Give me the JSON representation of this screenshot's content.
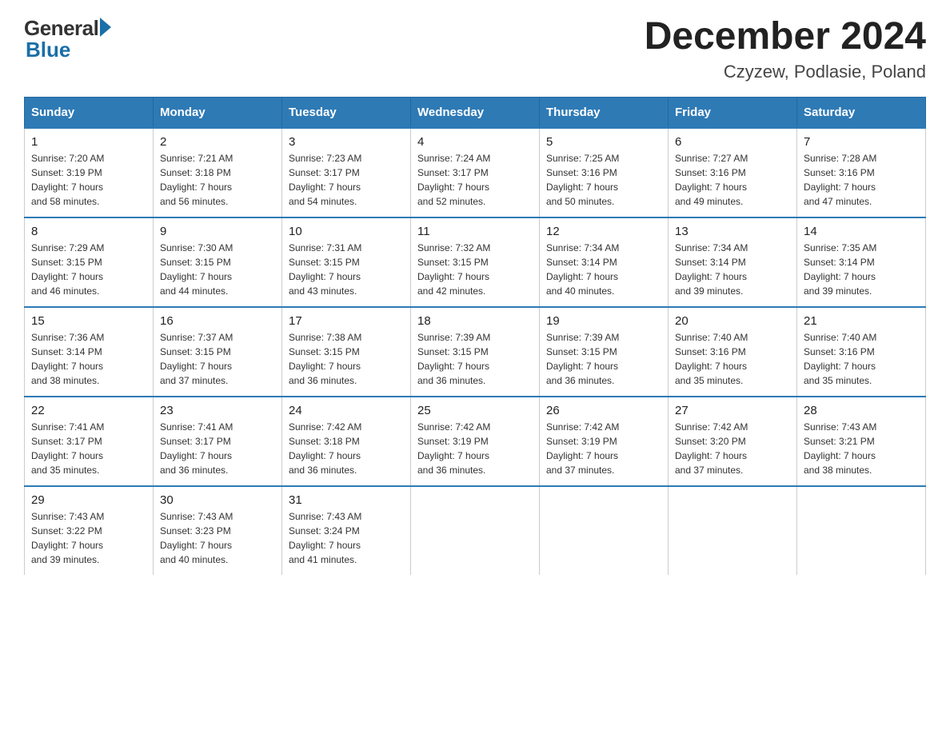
{
  "header": {
    "logo_general": "General",
    "logo_blue": "Blue",
    "title": "December 2024",
    "subtitle": "Czyzew, Podlasie, Poland"
  },
  "weekdays": [
    "Sunday",
    "Monday",
    "Tuesday",
    "Wednesday",
    "Thursday",
    "Friday",
    "Saturday"
  ],
  "weeks": [
    [
      {
        "day": "1",
        "sunrise": "Sunrise: 7:20 AM",
        "sunset": "Sunset: 3:19 PM",
        "daylight": "Daylight: 7 hours",
        "daylight2": "and 58 minutes."
      },
      {
        "day": "2",
        "sunrise": "Sunrise: 7:21 AM",
        "sunset": "Sunset: 3:18 PM",
        "daylight": "Daylight: 7 hours",
        "daylight2": "and 56 minutes."
      },
      {
        "day": "3",
        "sunrise": "Sunrise: 7:23 AM",
        "sunset": "Sunset: 3:17 PM",
        "daylight": "Daylight: 7 hours",
        "daylight2": "and 54 minutes."
      },
      {
        "day": "4",
        "sunrise": "Sunrise: 7:24 AM",
        "sunset": "Sunset: 3:17 PM",
        "daylight": "Daylight: 7 hours",
        "daylight2": "and 52 minutes."
      },
      {
        "day": "5",
        "sunrise": "Sunrise: 7:25 AM",
        "sunset": "Sunset: 3:16 PM",
        "daylight": "Daylight: 7 hours",
        "daylight2": "and 50 minutes."
      },
      {
        "day": "6",
        "sunrise": "Sunrise: 7:27 AM",
        "sunset": "Sunset: 3:16 PM",
        "daylight": "Daylight: 7 hours",
        "daylight2": "and 49 minutes."
      },
      {
        "day": "7",
        "sunrise": "Sunrise: 7:28 AM",
        "sunset": "Sunset: 3:16 PM",
        "daylight": "Daylight: 7 hours",
        "daylight2": "and 47 minutes."
      }
    ],
    [
      {
        "day": "8",
        "sunrise": "Sunrise: 7:29 AM",
        "sunset": "Sunset: 3:15 PM",
        "daylight": "Daylight: 7 hours",
        "daylight2": "and 46 minutes."
      },
      {
        "day": "9",
        "sunrise": "Sunrise: 7:30 AM",
        "sunset": "Sunset: 3:15 PM",
        "daylight": "Daylight: 7 hours",
        "daylight2": "and 44 minutes."
      },
      {
        "day": "10",
        "sunrise": "Sunrise: 7:31 AM",
        "sunset": "Sunset: 3:15 PM",
        "daylight": "Daylight: 7 hours",
        "daylight2": "and 43 minutes."
      },
      {
        "day": "11",
        "sunrise": "Sunrise: 7:32 AM",
        "sunset": "Sunset: 3:15 PM",
        "daylight": "Daylight: 7 hours",
        "daylight2": "and 42 minutes."
      },
      {
        "day": "12",
        "sunrise": "Sunrise: 7:34 AM",
        "sunset": "Sunset: 3:14 PM",
        "daylight": "Daylight: 7 hours",
        "daylight2": "and 40 minutes."
      },
      {
        "day": "13",
        "sunrise": "Sunrise: 7:34 AM",
        "sunset": "Sunset: 3:14 PM",
        "daylight": "Daylight: 7 hours",
        "daylight2": "and 39 minutes."
      },
      {
        "day": "14",
        "sunrise": "Sunrise: 7:35 AM",
        "sunset": "Sunset: 3:14 PM",
        "daylight": "Daylight: 7 hours",
        "daylight2": "and 39 minutes."
      }
    ],
    [
      {
        "day": "15",
        "sunrise": "Sunrise: 7:36 AM",
        "sunset": "Sunset: 3:14 PM",
        "daylight": "Daylight: 7 hours",
        "daylight2": "and 38 minutes."
      },
      {
        "day": "16",
        "sunrise": "Sunrise: 7:37 AM",
        "sunset": "Sunset: 3:15 PM",
        "daylight": "Daylight: 7 hours",
        "daylight2": "and 37 minutes."
      },
      {
        "day": "17",
        "sunrise": "Sunrise: 7:38 AM",
        "sunset": "Sunset: 3:15 PM",
        "daylight": "Daylight: 7 hours",
        "daylight2": "and 36 minutes."
      },
      {
        "day": "18",
        "sunrise": "Sunrise: 7:39 AM",
        "sunset": "Sunset: 3:15 PM",
        "daylight": "Daylight: 7 hours",
        "daylight2": "and 36 minutes."
      },
      {
        "day": "19",
        "sunrise": "Sunrise: 7:39 AM",
        "sunset": "Sunset: 3:15 PM",
        "daylight": "Daylight: 7 hours",
        "daylight2": "and 36 minutes."
      },
      {
        "day": "20",
        "sunrise": "Sunrise: 7:40 AM",
        "sunset": "Sunset: 3:16 PM",
        "daylight": "Daylight: 7 hours",
        "daylight2": "and 35 minutes."
      },
      {
        "day": "21",
        "sunrise": "Sunrise: 7:40 AM",
        "sunset": "Sunset: 3:16 PM",
        "daylight": "Daylight: 7 hours",
        "daylight2": "and 35 minutes."
      }
    ],
    [
      {
        "day": "22",
        "sunrise": "Sunrise: 7:41 AM",
        "sunset": "Sunset: 3:17 PM",
        "daylight": "Daylight: 7 hours",
        "daylight2": "and 35 minutes."
      },
      {
        "day": "23",
        "sunrise": "Sunrise: 7:41 AM",
        "sunset": "Sunset: 3:17 PM",
        "daylight": "Daylight: 7 hours",
        "daylight2": "and 36 minutes."
      },
      {
        "day": "24",
        "sunrise": "Sunrise: 7:42 AM",
        "sunset": "Sunset: 3:18 PM",
        "daylight": "Daylight: 7 hours",
        "daylight2": "and 36 minutes."
      },
      {
        "day": "25",
        "sunrise": "Sunrise: 7:42 AM",
        "sunset": "Sunset: 3:19 PM",
        "daylight": "Daylight: 7 hours",
        "daylight2": "and 36 minutes."
      },
      {
        "day": "26",
        "sunrise": "Sunrise: 7:42 AM",
        "sunset": "Sunset: 3:19 PM",
        "daylight": "Daylight: 7 hours",
        "daylight2": "and 37 minutes."
      },
      {
        "day": "27",
        "sunrise": "Sunrise: 7:42 AM",
        "sunset": "Sunset: 3:20 PM",
        "daylight": "Daylight: 7 hours",
        "daylight2": "and 37 minutes."
      },
      {
        "day": "28",
        "sunrise": "Sunrise: 7:43 AM",
        "sunset": "Sunset: 3:21 PM",
        "daylight": "Daylight: 7 hours",
        "daylight2": "and 38 minutes."
      }
    ],
    [
      {
        "day": "29",
        "sunrise": "Sunrise: 7:43 AM",
        "sunset": "Sunset: 3:22 PM",
        "daylight": "Daylight: 7 hours",
        "daylight2": "and 39 minutes."
      },
      {
        "day": "30",
        "sunrise": "Sunrise: 7:43 AM",
        "sunset": "Sunset: 3:23 PM",
        "daylight": "Daylight: 7 hours",
        "daylight2": "and 40 minutes."
      },
      {
        "day": "31",
        "sunrise": "Sunrise: 7:43 AM",
        "sunset": "Sunset: 3:24 PM",
        "daylight": "Daylight: 7 hours",
        "daylight2": "and 41 minutes."
      },
      null,
      null,
      null,
      null
    ]
  ]
}
